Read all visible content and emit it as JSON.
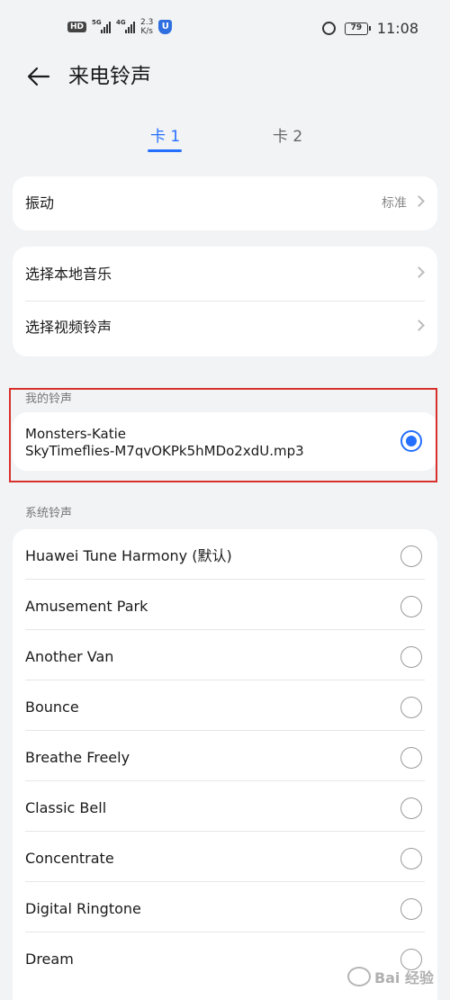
{
  "status_bar": {
    "hd": "HD",
    "sim1": "5G",
    "sim2": "4G",
    "speed_value": "2.3",
    "speed_unit": "K/s",
    "shield_text": "U",
    "battery": "79",
    "time": "11:08"
  },
  "header": {
    "title": "来电铃声"
  },
  "tabs": [
    {
      "label": "卡 1",
      "active": true
    },
    {
      "label": "卡 2",
      "active": false
    }
  ],
  "vibration": {
    "label": "振动",
    "value": "标准"
  },
  "sources": [
    {
      "label": "选择本地音乐"
    },
    {
      "label": "选择视频铃声"
    }
  ],
  "my_ringtones": {
    "section_label": "我的铃声",
    "item_line1": "Monsters-Katie",
    "item_line2": "SkyTimeflies-M7qvOKPk5hMDo2xdU.mp3",
    "selected": true
  },
  "system_ringtones": {
    "section_label": "系统铃声",
    "items": [
      {
        "label": "Huawei Tune Harmony (默认)"
      },
      {
        "label": "Amusement Park"
      },
      {
        "label": "Another Van"
      },
      {
        "label": "Bounce"
      },
      {
        "label": "Breathe Freely"
      },
      {
        "label": "Classic Bell"
      },
      {
        "label": "Concentrate"
      },
      {
        "label": "Digital Ringtone"
      },
      {
        "label": "Dream"
      }
    ]
  },
  "watermark": "Bai 经验",
  "colors": {
    "accent": "#256fff",
    "background": "#f1f3f5",
    "highlight_border": "#d8312c"
  }
}
